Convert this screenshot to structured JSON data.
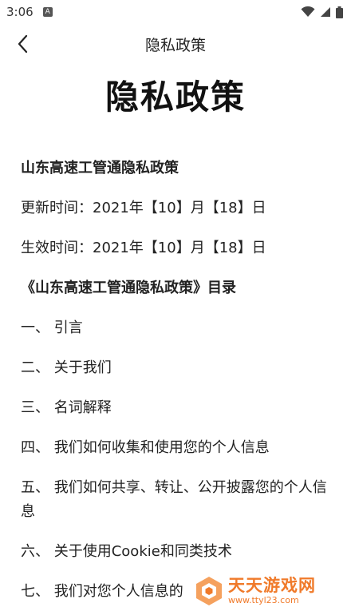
{
  "status_bar": {
    "time": "3:06",
    "notification_glyph": "A",
    "icons": [
      "wifi-icon",
      "signal-icon",
      "battery-icon"
    ]
  },
  "nav": {
    "title": "隐私政策",
    "back_icon": "chevron-left-icon"
  },
  "document": {
    "title": "隐私政策",
    "policy_name": "山东高速工管通隐私政策",
    "updated": "更新时间：2021年【10】月【18】日",
    "effective": "生效时间：2021年【10】月【18】日",
    "toc_heading": "《山东高速工管通隐私政策》目录",
    "toc": [
      "一、 引言",
      "二、 关于我们",
      "三、 名词解释",
      "四、 我们如何收集和使用您的个人信息",
      "五、 我们如何共享、转让、公开披露您的个人信息",
      "六、 关于使用Cookie和同类技术",
      "七、 我们对您个人信息的"
    ]
  },
  "watermark": {
    "name": "天天游戏网",
    "url": "www.ttyl23.com",
    "color": "#f07a2a"
  }
}
